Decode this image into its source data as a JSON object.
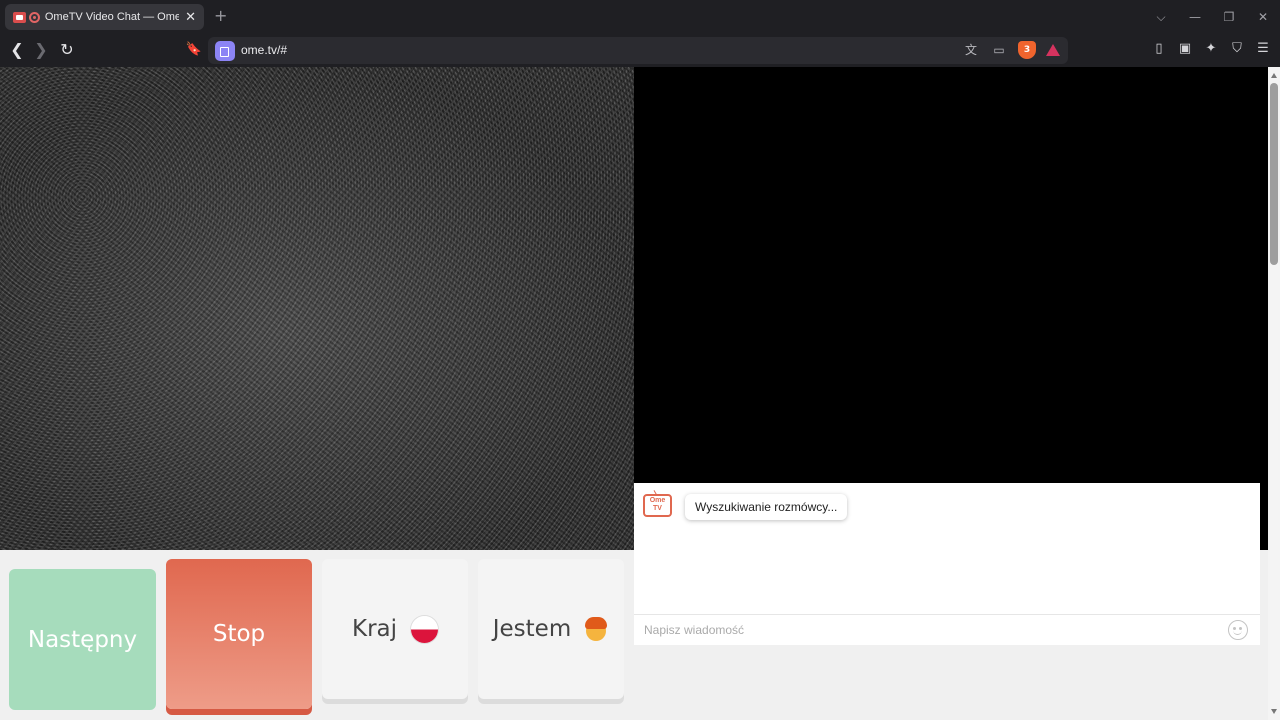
{
  "browser": {
    "tab": {
      "title": "OmeTV Video Chat — Omegl",
      "close": "✕"
    },
    "new_tab": "+",
    "window": {
      "dropdown": "⌵",
      "minimize": "—",
      "restore": "❐",
      "close": "✕"
    },
    "nav": {
      "back": "❮",
      "forward": "❯",
      "reload": "↻",
      "bookmark": "🔖"
    },
    "address": {
      "url": "ome.tv/#"
    },
    "addr_icons": {
      "translate": "文",
      "cast": "▭",
      "brave_badge": "3"
    },
    "right_icons": {
      "sidebar": "▯",
      "wallet": "▣",
      "leo": "✦",
      "vpn": "⛉",
      "menu": "☰"
    }
  },
  "controls": {
    "next_label": "Następny",
    "stop_label": "Stop",
    "country_label": "Kraj",
    "gender_label": "Jestem"
  },
  "chat": {
    "logo_text": "Ome TV",
    "status_message": "Wyszukiwanie rozmówcy...",
    "input_placeholder": "Napisz wiadomość"
  },
  "colors": {
    "next": "#a6dcbc",
    "stop": "#e0684f",
    "accent_logo": "#e0684f"
  }
}
